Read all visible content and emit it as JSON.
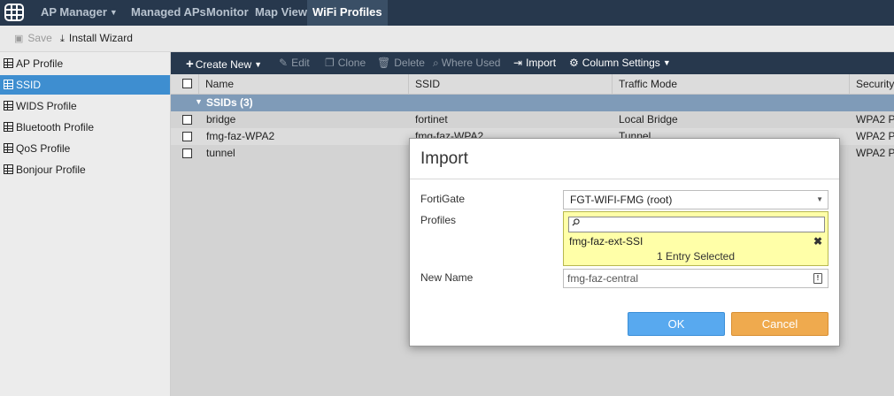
{
  "colors": {
    "topbar": "#27384d",
    "selected": "#3e8ed0",
    "ok": "#58a9ef",
    "cancel": "#efaa4e"
  },
  "topnav": {
    "logo_icon": "grid-logo-icon",
    "items": [
      {
        "label": "AP Manager",
        "dropdown": true
      },
      {
        "label": "Managed APs"
      },
      {
        "label": "Monitor"
      },
      {
        "label": "Map View"
      },
      {
        "label": "WiFi Profiles",
        "active": true
      }
    ]
  },
  "toolbar": {
    "save_label": "Save",
    "install_label": "Install Wizard"
  },
  "sidebar": {
    "items": [
      {
        "label": "AP Profile"
      },
      {
        "label": "SSID",
        "selected": true
      },
      {
        "label": "WIDS Profile"
      },
      {
        "label": "Bluetooth Profile"
      },
      {
        "label": "QoS Profile"
      },
      {
        "label": "Bonjour Profile"
      }
    ]
  },
  "content_toolbar": {
    "create_new": "Create New",
    "edit": "Edit",
    "clone": "Clone",
    "delete": "Delete",
    "where_used": "Where Used",
    "import": "Import",
    "column_settings": "Column Settings"
  },
  "table": {
    "columns": [
      "Name",
      "SSID",
      "Traffic Mode",
      "Security"
    ],
    "group_label": "SSIDs (3)",
    "rows": [
      {
        "name": "bridge",
        "ssid": "fortinet",
        "traffic_mode": "Local Bridge",
        "security": "WPA2 P"
      },
      {
        "name": "fmg-faz-WPA2",
        "ssid": "fmg-faz-WPA2",
        "traffic_mode": "Tunnel",
        "security": "WPA2 P"
      },
      {
        "name": "tunnel",
        "ssid": "",
        "traffic_mode": "",
        "security": "WPA2 P"
      }
    ]
  },
  "dialog": {
    "title": "Import",
    "fortigate_label": "FortiGate",
    "fortigate_value": "FGT-WIFI-FMG (root)",
    "profiles_label": "Profiles",
    "profiles_search_placeholder": "",
    "profiles_selected_item": "fmg-faz-ext-SSI",
    "profiles_count": "1 Entry Selected",
    "new_name_label": "New Name",
    "new_name_value": "fmg-faz-central",
    "ok_label": "OK",
    "cancel_label": "Cancel"
  }
}
